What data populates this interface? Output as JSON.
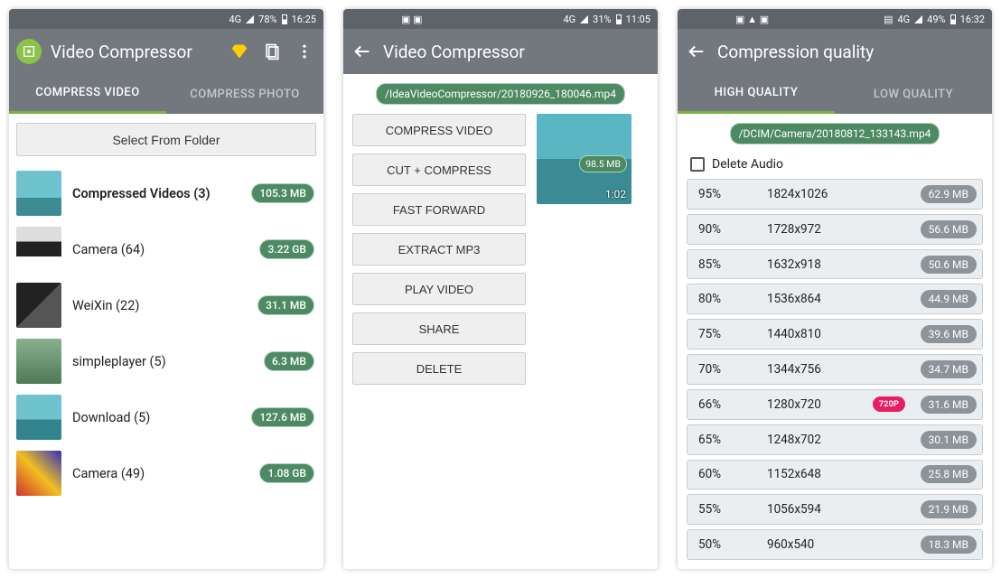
{
  "screen1": {
    "status": {
      "left": "4G",
      "pct": "78%",
      "time": "16:25"
    },
    "title": "Video Compressor",
    "tabs": [
      "COMPRESS VIDEO",
      "COMPRESS PHOTO"
    ],
    "active_tab": 0,
    "select_folder_label": "Select From Folder",
    "folders": [
      {
        "label": "Compressed Videos (3)",
        "size": "105.3 MB",
        "bold": true,
        "thumb": "pool"
      },
      {
        "label": "Camera (64)",
        "size": "3.22 GB",
        "thumb": "table"
      },
      {
        "label": "WeiXin (22)",
        "size": "31.1 MB",
        "thumb": "dark"
      },
      {
        "label": "simpleplayer (5)",
        "size": "6.3 MB",
        "thumb": "mount"
      },
      {
        "label": "Download (5)",
        "size": "127.6 MB",
        "thumb": "pool2"
      },
      {
        "label": "Camera (49)",
        "size": "1.08 GB",
        "thumb": "color"
      }
    ]
  },
  "screen2": {
    "status": {
      "left": "4G",
      "pct": "31%",
      "time": "11:05"
    },
    "title": "Video Compressor",
    "path": "/IdeaVideoCompressor/20180926_180046.mp4",
    "actions": [
      "COMPRESS VIDEO",
      "CUT + COMPRESS",
      "FAST FORWARD",
      "EXTRACT MP3",
      "PLAY VIDEO",
      "SHARE",
      "DELETE"
    ],
    "preview_size": "98.5 MB",
    "preview_duration": "1:02"
  },
  "screen3": {
    "status": {
      "left": "4G",
      "pct": "49%",
      "time": "16:32"
    },
    "title": "Compression quality",
    "tabs": [
      "HIGH QUALITY",
      "LOW QUALITY"
    ],
    "active_tab": 0,
    "path": "/DCIM/Camera/20180812_133143.mp4",
    "delete_audio_label": "Delete Audio",
    "rows": [
      {
        "pct": "95%",
        "res": "1824x1026",
        "size": "62.9 MB"
      },
      {
        "pct": "90%",
        "res": "1728x972",
        "size": "56.6 MB"
      },
      {
        "pct": "85%",
        "res": "1632x918",
        "size": "50.6 MB"
      },
      {
        "pct": "80%",
        "res": "1536x864",
        "size": "44.9 MB"
      },
      {
        "pct": "75%",
        "res": "1440x810",
        "size": "39.6 MB"
      },
      {
        "pct": "70%",
        "res": "1344x756",
        "size": "34.7 MB"
      },
      {
        "pct": "66%",
        "res": "1280x720",
        "size": "31.6 MB",
        "badge": "720P"
      },
      {
        "pct": "65%",
        "res": "1248x702",
        "size": "30.1 MB"
      },
      {
        "pct": "60%",
        "res": "1152x648",
        "size": "25.8 MB"
      },
      {
        "pct": "55%",
        "res": "1056x594",
        "size": "21.9 MB"
      },
      {
        "pct": "50%",
        "res": "960x540",
        "size": "18.3 MB"
      }
    ]
  },
  "thumb_styles": {
    "pool": "linear-gradient(#6ec3cf 60%, #3d8c94 60%)",
    "table": "linear-gradient(#ddd 33%,#222 33% 66%,#fff 66%)",
    "dark": "linear-gradient(135deg,#222 50%,#555 50%)",
    "mount": "linear-gradient(#8ab08e, #4e7a55)",
    "pool2": "linear-gradient(#6ec3cf 55%, #34848d 55%)",
    "color": "linear-gradient(45deg,#d03030,#f0c020,#3030c0)"
  }
}
